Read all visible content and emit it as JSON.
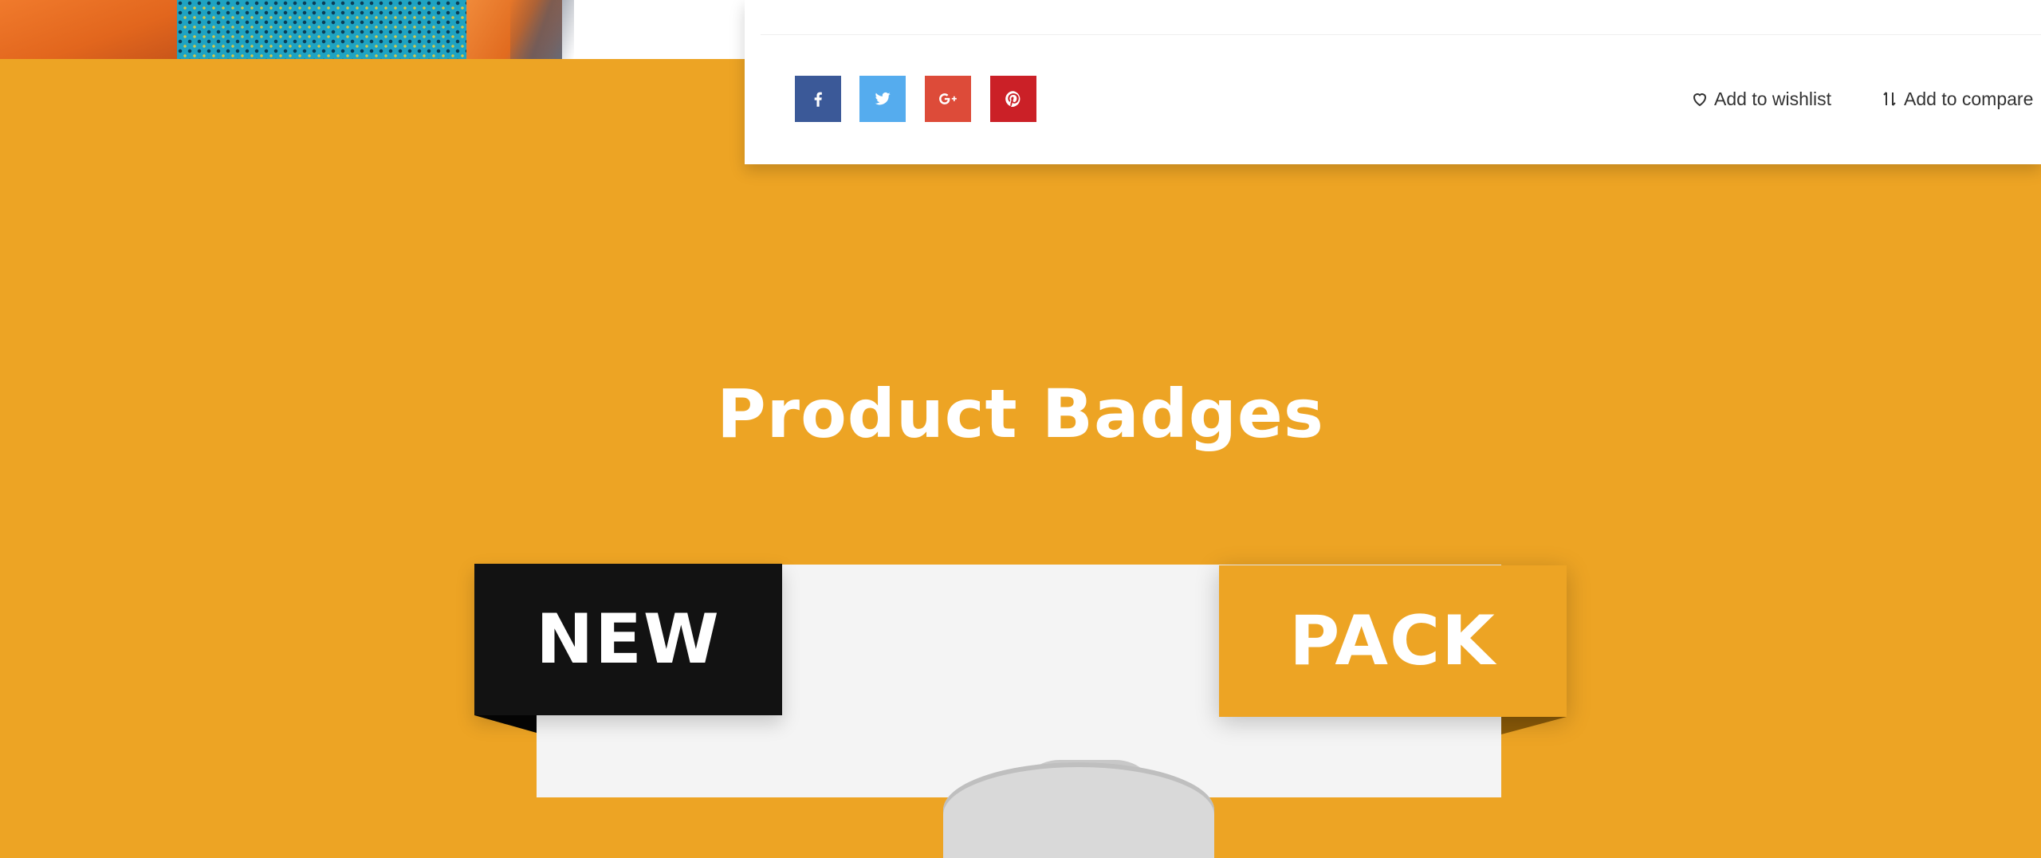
{
  "product_info": {
    "share_buttons": [
      {
        "network": "facebook",
        "icon": "facebook-icon",
        "color": "#3b5998"
      },
      {
        "network": "twitter",
        "icon": "twitter-icon",
        "color": "#55acee"
      },
      {
        "network": "google-plus",
        "icon": "google-plus-icon",
        "color": "#dd4b39"
      },
      {
        "network": "pinterest",
        "icon": "pinterest-icon",
        "color": "#cb2027"
      }
    ],
    "wishlist_label": "Add to wishlist",
    "compare_label": "Add to compare"
  },
  "section": {
    "title": "Product Badges",
    "background_color": "#eda424"
  },
  "badges": {
    "new_label": "NEW",
    "new_color": "#121212",
    "pack_label": "PACK",
    "pack_color": "#eda424"
  }
}
